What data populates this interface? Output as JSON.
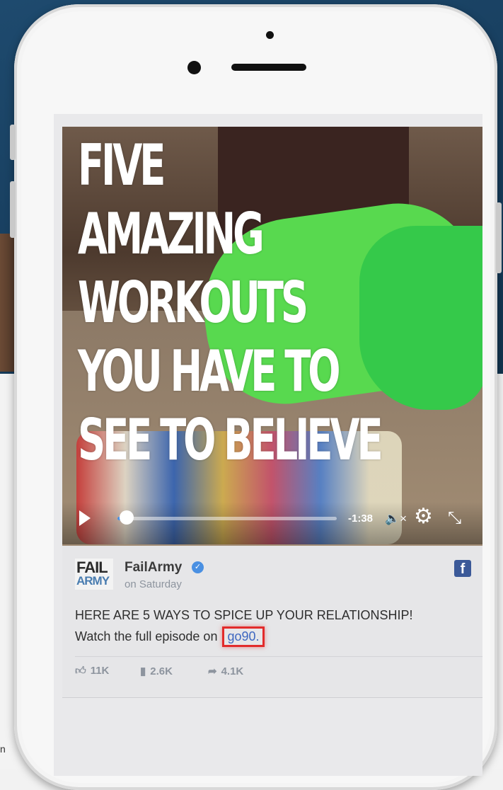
{
  "video": {
    "headline": [
      "FIVE",
      "AMAZING",
      "WORKOUTS",
      "YOU HAVE TO",
      "SEE TO BELIEVE"
    ],
    "time_remaining": "-1:38",
    "progress": 0.03
  },
  "post": {
    "logo_line1": "FAIL",
    "logo_line2": "ARMY",
    "page_name": "FailArmy",
    "time": "on Saturday",
    "text_line1": "HERE ARE 5 WAYS TO SPICE UP YOUR RELATIONSHIP!",
    "text_line2_prefix": "Watch the full episode on",
    "link_text": "go90."
  },
  "stats": {
    "likes": "11K",
    "comments": "2.6K",
    "shares": "4.1K"
  },
  "page_edge_text": "n",
  "icons": {
    "play": "play-icon",
    "mute": "mute-icon",
    "settings": "gear-icon",
    "fullscreen": "expand-icon",
    "verified": "verified-badge-icon",
    "facebook": "facebook-icon",
    "like": "thumbs-up-icon",
    "comment": "comment-icon",
    "share": "share-arrow-icon"
  },
  "colors": {
    "link": "#3e67c0",
    "highlight_box": "#e22b2b",
    "facebook": "#3b5998",
    "verified": "#4a90e2"
  }
}
